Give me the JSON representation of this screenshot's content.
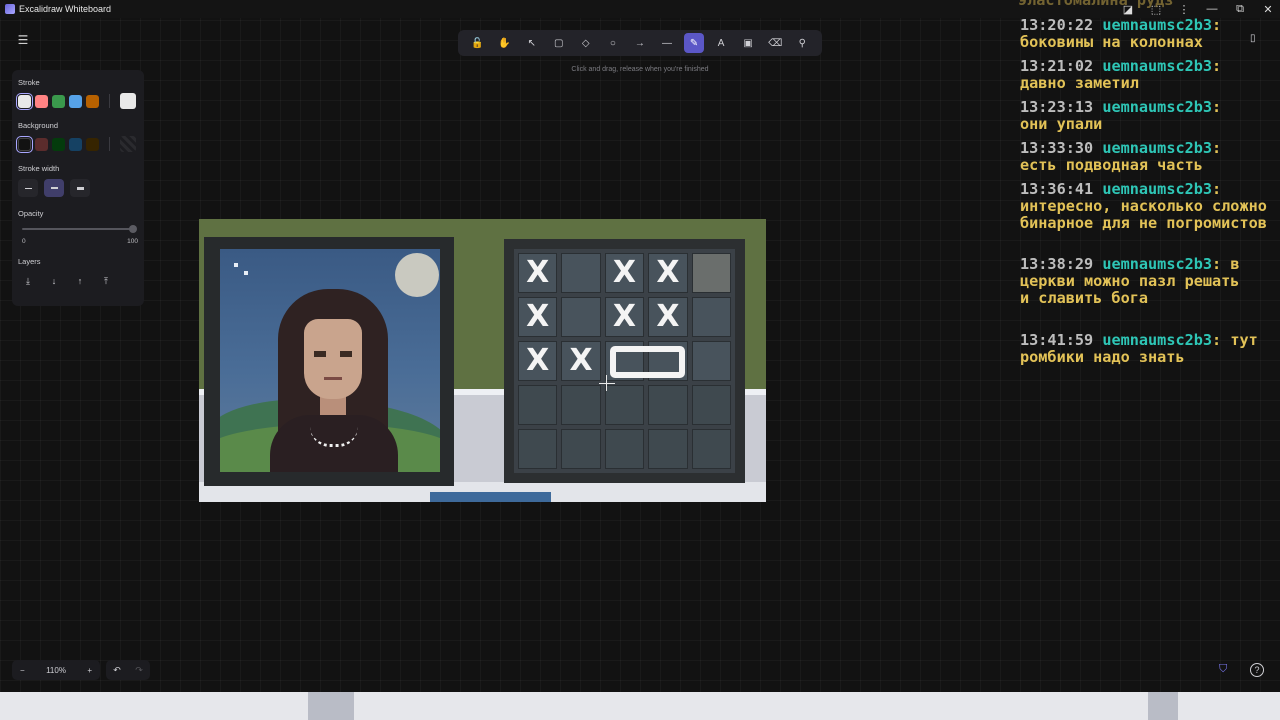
{
  "window": {
    "title": "Excalidraw Whiteboard",
    "controls": [
      "◪",
      "⬚",
      "⋮",
      "—",
      "⧉",
      "✕"
    ]
  },
  "toolbar": {
    "tools": [
      {
        "name": "lock",
        "glyph": "🔓"
      },
      {
        "name": "hand",
        "glyph": "✋"
      },
      {
        "name": "selection",
        "glyph": "↖"
      },
      {
        "name": "rectangle",
        "glyph": "▢"
      },
      {
        "name": "diamond",
        "glyph": "◇"
      },
      {
        "name": "ellipse",
        "glyph": "○"
      },
      {
        "name": "arrow",
        "glyph": "→"
      },
      {
        "name": "line",
        "glyph": "—"
      },
      {
        "name": "draw",
        "glyph": "✎"
      },
      {
        "name": "text",
        "glyph": "A"
      },
      {
        "name": "image",
        "glyph": "▣"
      },
      {
        "name": "eraser",
        "glyph": "⌫"
      },
      {
        "name": "more",
        "glyph": "⚲"
      }
    ],
    "active": "draw",
    "hint": "Click and drag, release when you're finished"
  },
  "props": {
    "stroke_label": "Stroke",
    "stroke_colors": [
      "#e8e8e8",
      "#ff8383",
      "#3a994c",
      "#56a2e8",
      "#b76100"
    ],
    "stroke_current": "#e8e8e8",
    "background_label": "Background",
    "background_colors": [
      "#121212",
      "#5b2c2c",
      "#043b0c",
      "#154163",
      "#362400"
    ],
    "stroke_width_label": "Stroke width",
    "opacity_label": "Opacity",
    "opacity_min": "0",
    "opacity_max": "100",
    "opacity_value": 100,
    "layers_label": "Layers",
    "layer_buttons": [
      "⤓",
      "↓",
      "↑",
      "⤒"
    ]
  },
  "zoom": {
    "out": "−",
    "value": "110%",
    "in": "+"
  },
  "history": {
    "undo": "↶",
    "redo": "↷"
  },
  "chat": {
    "partial_top": "эластомалина рудз",
    "messages": [
      {
        "time": "13:20:22",
        "user": "uemnaumsc2b3",
        "text": "боковины на колоннах"
      },
      {
        "time": "13:21:02",
        "user": "uemnaumsc2b3",
        "text": "давно заметил"
      },
      {
        "time": "13:23:13",
        "user": "uemnaumsc2b3",
        "text": "они упали"
      },
      {
        "time": "13:33:30",
        "user": "uemnaumsc2b3",
        "text": "есть подводная часть"
      },
      {
        "time": "13:36:41",
        "user": "uemnaumsc2b3",
        "text": "интересно, насколько сложно бинарное для не погромистов"
      },
      {
        "time": "13:38:29",
        "user": "uemnaumsc2b3",
        "text": "в церкви можно пазл решать\nи славить бога"
      },
      {
        "time": "13:41:59",
        "user": "uemnaumsc2b3",
        "text": "тут ромбики надо знать"
      }
    ]
  },
  "puzzle": {
    "marks": [
      "X",
      "",
      "X",
      "X",
      "",
      "X",
      "",
      "X",
      "X",
      "",
      "X",
      "X",
      "",
      "",
      "",
      "",
      "",
      "",
      "",
      "",
      "",
      "",
      "",
      "",
      ""
    ]
  },
  "colors": {
    "accent": "#5b57c7",
    "chat_text": "#e2c257",
    "chat_user": "#2ec6b6"
  }
}
